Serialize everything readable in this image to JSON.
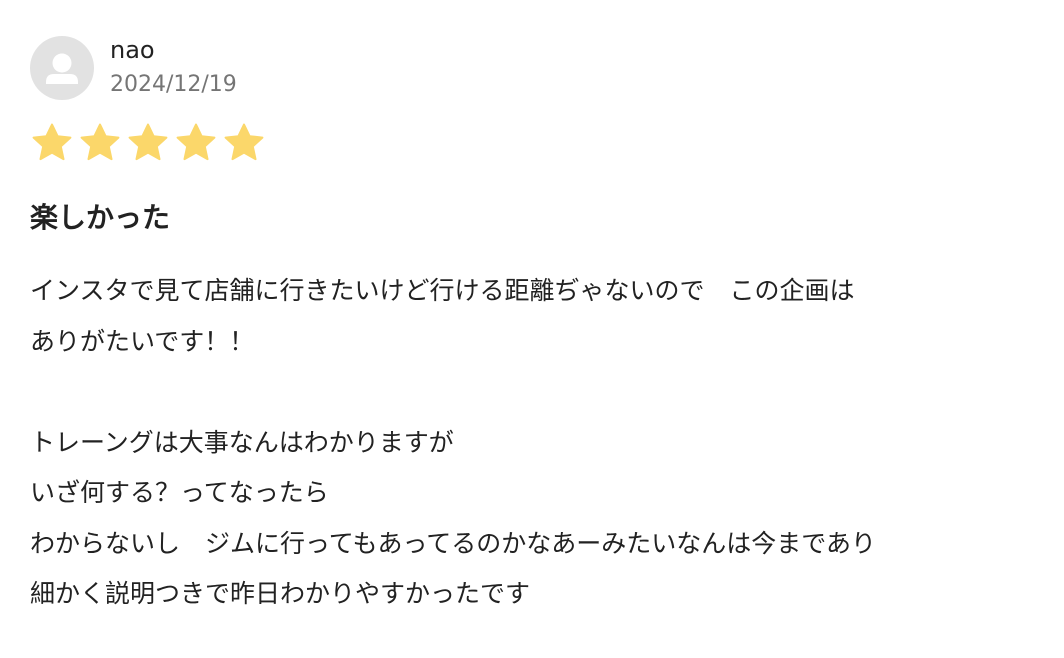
{
  "review": {
    "user": {
      "name": "nao",
      "avatar_icon": "user-placeholder-icon"
    },
    "date": "2024/12/19",
    "rating": {
      "value": 5,
      "max": 5,
      "star_icon": "star-icon",
      "color_filled": "#fbd76a"
    },
    "title": "楽しかった",
    "body_lines": [
      "インスタで見て店舗に行きたいけど行ける距離ぢゃないので　この企画は",
      "ありがたいです！！",
      "",
      "トレーングは大事なんはわかりますが",
      "いざ何する？ってなったら",
      "わからないし　ジムに行ってもあってるのかなあーみたいなんは今まであり",
      "細かく説明つきで昨日わかりやすかったです"
    ]
  }
}
